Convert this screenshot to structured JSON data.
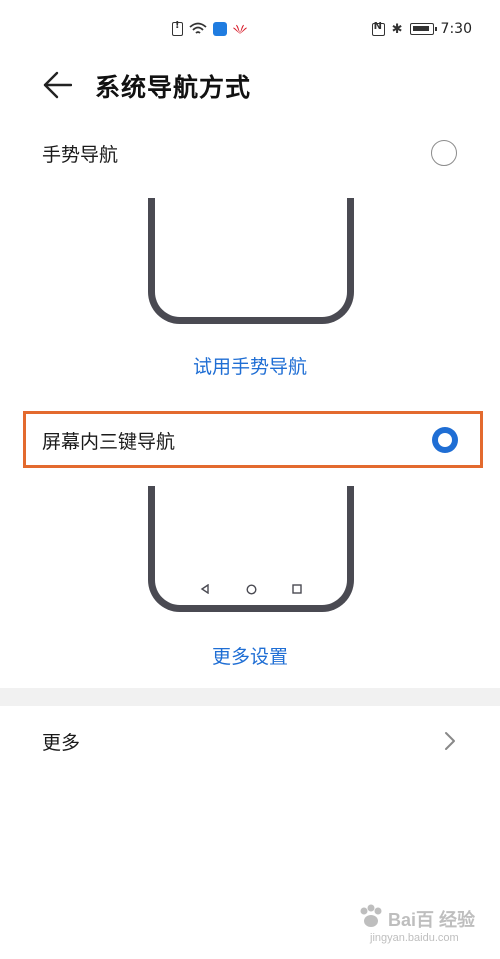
{
  "status_bar": {
    "time": "7:30",
    "left_icons": [
      "sim-alert-icon",
      "wifi-icon",
      "cloud-icon",
      "huawei-logo-icon"
    ],
    "right_icons": [
      "nfc-icon",
      "bluetooth-icon",
      "battery-icon"
    ]
  },
  "header": {
    "title": "系统导航方式",
    "back_icon": "arrow-left-icon"
  },
  "options": [
    {
      "label": "手势导航",
      "selected": false,
      "link": "试用手势导航"
    },
    {
      "label": "屏幕内三键导航",
      "selected": true,
      "link": "更多设置"
    }
  ],
  "more": {
    "label": "更多",
    "icon": "chevron-right-icon"
  },
  "watermark": {
    "brand": "Bai百 经验",
    "url": "jingyan.baidu.com"
  },
  "colors": {
    "accent": "#1f6ed4",
    "highlight": "#e36a2e",
    "phone_frame": "#4a4a52",
    "divider": "#f1f1f1"
  }
}
